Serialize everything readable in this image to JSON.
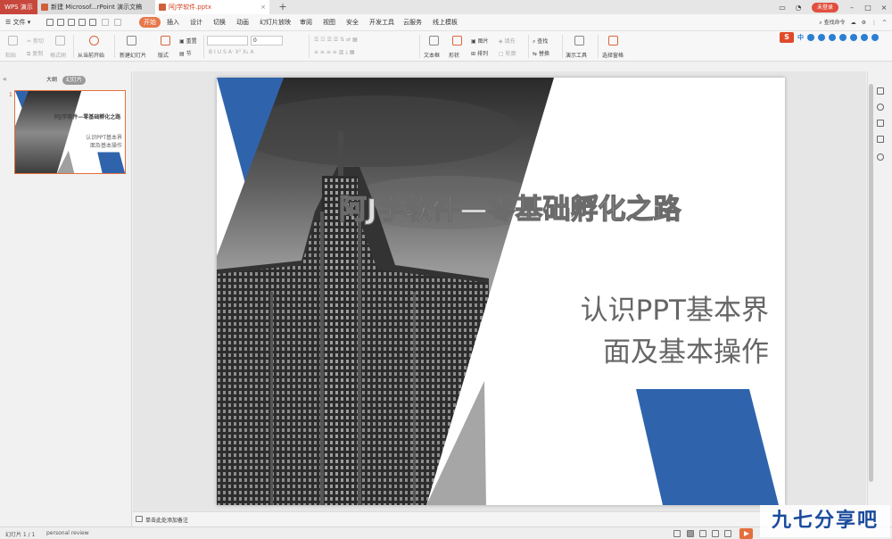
{
  "app": {
    "name": "WPS 演示"
  },
  "tabs": [
    {
      "label": "新建 Microsof...rPoint 演示文稿"
    },
    {
      "label": "阿J学软件.pptx"
    }
  ],
  "tabbar": {
    "login_label": "未登录"
  },
  "menu": {
    "file_label": "文件",
    "items": [
      "开始",
      "插入",
      "设计",
      "切换",
      "动画",
      "幻灯片放映",
      "审阅",
      "视图",
      "安全",
      "开发工具",
      "云服务",
      "线上模板"
    ],
    "active_index": 0,
    "search_label": "查找命令"
  },
  "ribbon": {
    "paste": "粘贴",
    "cut": "剪切",
    "copy": "复制",
    "format_painter": "格式刷",
    "from_current": "从当前开始",
    "new_slide": "新建幻灯片",
    "layout": "版式",
    "reset": "重置",
    "section": "节",
    "font_size": "0",
    "text_box": "文本框",
    "shape": "形状",
    "picture": "图片",
    "arrange": "排列",
    "fill": "填充",
    "outline": "轮廓",
    "find": "查找",
    "replace": "替换",
    "presentation_tools": "演示工具",
    "select_pane": "选择窗格"
  },
  "ime": {
    "logo": "S",
    "lang": "中"
  },
  "left_panel": {
    "outline_tab": "大纲",
    "slides_tab": "幻灯片",
    "thumb_number": "1",
    "thumb_title": "阿J学软件—零基础孵化之路",
    "thumb_sub1": "认识PPT基本界",
    "thumb_sub2": "面及基本操作"
  },
  "slide": {
    "title": "阿J学软件—零基础孵化之路",
    "subtitle_line1": "认识PPT基本界",
    "subtitle_line2": "面及基本操作",
    "accent_color": "#2f64ad"
  },
  "notes": {
    "placeholder": "单击此处添加备注"
  },
  "status": {
    "slide_counter": "幻灯片 1 / 1",
    "theme_name": "personal review"
  },
  "watermark": {
    "text": "九七分享吧"
  }
}
